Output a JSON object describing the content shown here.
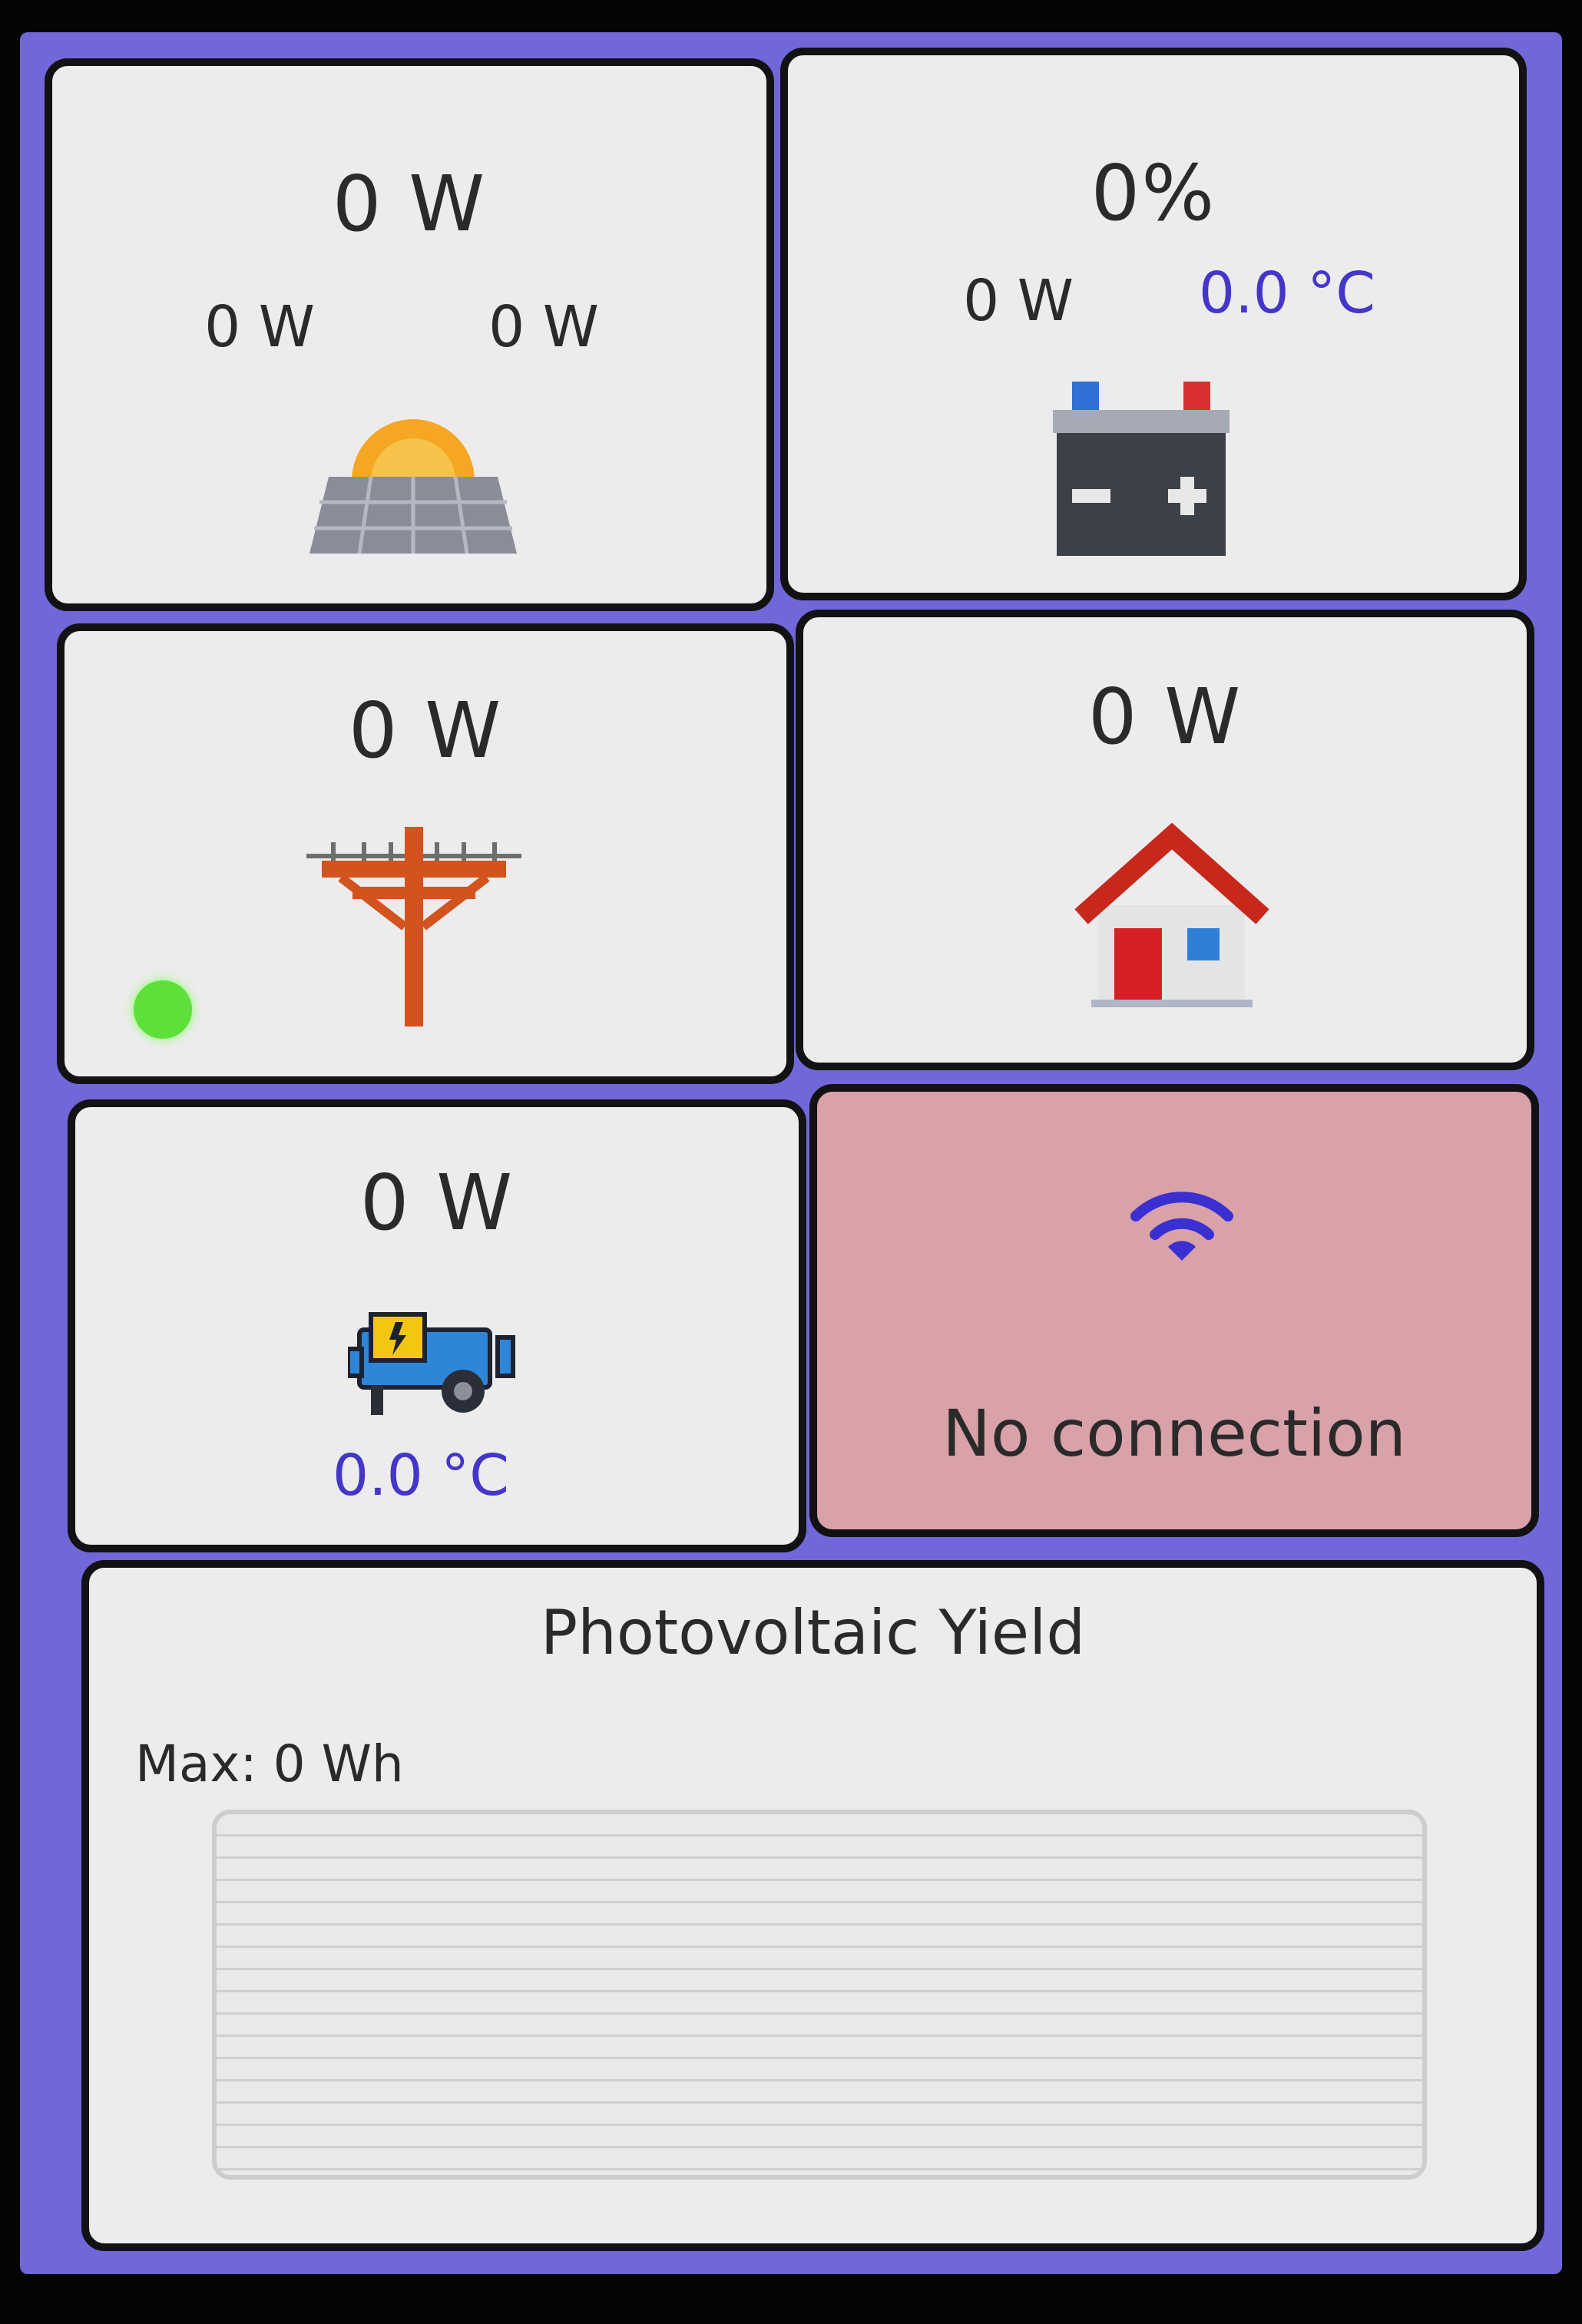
{
  "solar": {
    "total": "0 W",
    "string1": "0 W",
    "string2": "0 W",
    "icon": "solar-panel-icon"
  },
  "battery": {
    "soc": "0%",
    "power": "0 W",
    "temperature": "0.0 °C",
    "icon": "battery-icon"
  },
  "grid": {
    "power": "0 W",
    "status_color": "#5ee03a",
    "icon": "power-pole-icon"
  },
  "house": {
    "power": "0 W",
    "icon": "house-icon"
  },
  "generator": {
    "power": "0 W",
    "temperature": "0.0 °C",
    "icon": "generator-icon"
  },
  "connection": {
    "status": "No connection",
    "icon": "wifi-icon",
    "alert_color": "#d9a2a9"
  },
  "pv_yield": {
    "title": "Photovoltaic Yield",
    "max_label": "Max: 0 Wh"
  }
}
